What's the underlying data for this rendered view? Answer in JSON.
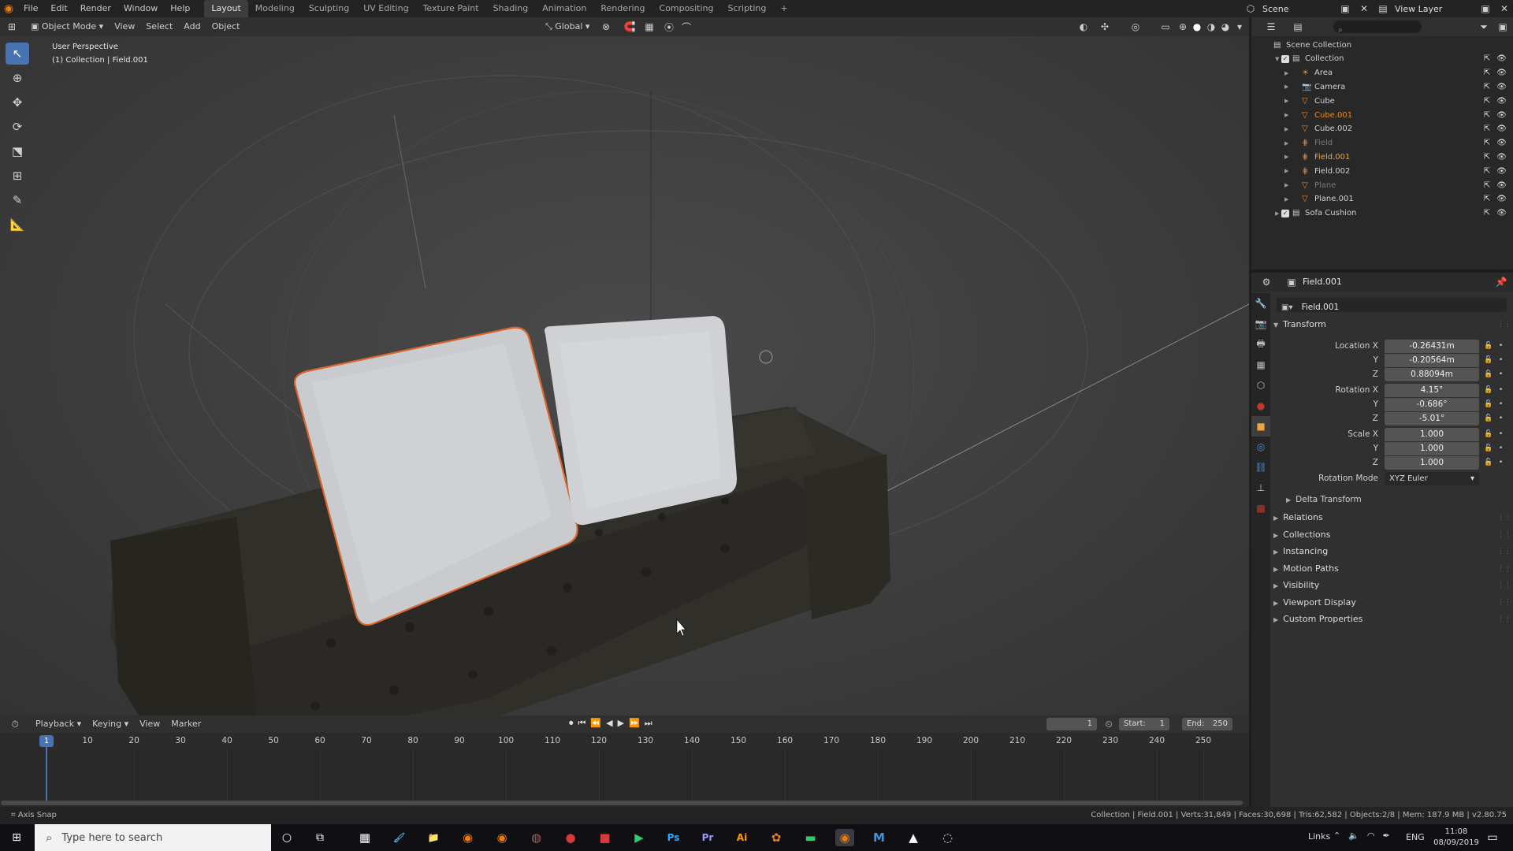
{
  "topbar": {
    "menus": [
      "File",
      "Edit",
      "Render",
      "Window",
      "Help"
    ],
    "workspaces": [
      "Layout",
      "Modeling",
      "Sculpting",
      "UV Editing",
      "Texture Paint",
      "Shading",
      "Animation",
      "Rendering",
      "Compositing",
      "Scripting"
    ],
    "add_tab": "+",
    "scene": "Scene",
    "view_layer": "View Layer"
  },
  "viewport_header": {
    "mode": "Object Mode",
    "menus": [
      "View",
      "Select",
      "Add",
      "Object"
    ],
    "orientation": "Global"
  },
  "viewport": {
    "perspective": "User Perspective",
    "collection_info": "(1) Collection | Field.001"
  },
  "outliner": {
    "root": "Scene Collection",
    "items": [
      {
        "name": "Collection",
        "indent": 0,
        "type": "collection",
        "color": "#d0d0d0"
      },
      {
        "name": "Area",
        "indent": 1,
        "type": "light",
        "color": "#d0d0d0"
      },
      {
        "name": "Camera",
        "indent": 1,
        "type": "camera",
        "color": "#d0d0d0"
      },
      {
        "name": "Cube",
        "indent": 1,
        "type": "mesh",
        "color": "#d0d0d0"
      },
      {
        "name": "Cube.001",
        "indent": 1,
        "type": "mesh",
        "color": "#e9872a"
      },
      {
        "name": "Cube.002",
        "indent": 1,
        "type": "mesh",
        "color": "#d0d0d0"
      },
      {
        "name": "Field",
        "indent": 1,
        "type": "field",
        "color": "#7a7a7a"
      },
      {
        "name": "Field.001",
        "indent": 1,
        "type": "field",
        "color": "#f0a33a"
      },
      {
        "name": "Field.002",
        "indent": 1,
        "type": "field",
        "color": "#d0d0d0"
      },
      {
        "name": "Plane",
        "indent": 1,
        "type": "mesh",
        "color": "#7a7a7a"
      },
      {
        "name": "Plane.001",
        "indent": 1,
        "type": "mesh",
        "color": "#d0d0d0"
      },
      {
        "name": "Sofa Cushion",
        "indent": 0,
        "type": "collection",
        "color": "#d0d0d0"
      }
    ]
  },
  "properties": {
    "header_object": "Field.001",
    "object_name": "Field.001",
    "transform_title": "Transform",
    "location_label": "Location X",
    "rotation_label": "Rotation X",
    "scale_label": "Scale X",
    "y_label": "Y",
    "z_label": "Z",
    "location": [
      "-0.26431m",
      "-0.20564m",
      "0.88094m"
    ],
    "rotation": [
      "4.15°",
      "-0.686°",
      "-5.01°"
    ],
    "scale": [
      "1.000",
      "1.000",
      "1.000"
    ],
    "rotation_mode_label": "Rotation Mode",
    "rotation_mode": "XYZ Euler",
    "delta_transform": "Delta Transform",
    "panels": [
      "Relations",
      "Collections",
      "Instancing",
      "Motion Paths",
      "Visibility",
      "Viewport Display",
      "Custom Properties"
    ]
  },
  "timeline": {
    "menus": [
      "Playback",
      "Keying",
      "View",
      "Marker"
    ],
    "current_frame": "1",
    "start_label": "Start:",
    "start": "1",
    "end_label": "End:",
    "end": "250",
    "ruler": [
      "1",
      "10",
      "20",
      "30",
      "40",
      "50",
      "60",
      "70",
      "80",
      "90",
      "100",
      "110",
      "120",
      "130",
      "140",
      "150",
      "160",
      "170",
      "180",
      "190",
      "200",
      "210",
      "220",
      "230",
      "240",
      "250"
    ]
  },
  "status": {
    "left": "Axis Snap",
    "right": "Collection | Field.001 | Verts:31,849 | Faces:30,698 | Tris:62,582 | Objects:2/8 | Mem: 187.9 MB | v2.80.75"
  },
  "taskbar": {
    "search_placeholder": "Type here to search",
    "links": "Links",
    "lang": "ENG",
    "time": "11:08",
    "date": "08/09/2019",
    "apps": [
      "calculator",
      "paint",
      "explorer",
      "blender",
      "blender-beta",
      "chrome",
      "app-red",
      "app-red-2",
      "play",
      "photoshop",
      "premiere",
      "illustrator",
      "colors",
      "green-app",
      "blender-active",
      "vscode",
      "photos",
      "steam"
    ]
  },
  "colors": {
    "accent_blue": "#4772b3",
    "selected_orange": "#e9872a",
    "active_orange": "#f0a33a"
  }
}
